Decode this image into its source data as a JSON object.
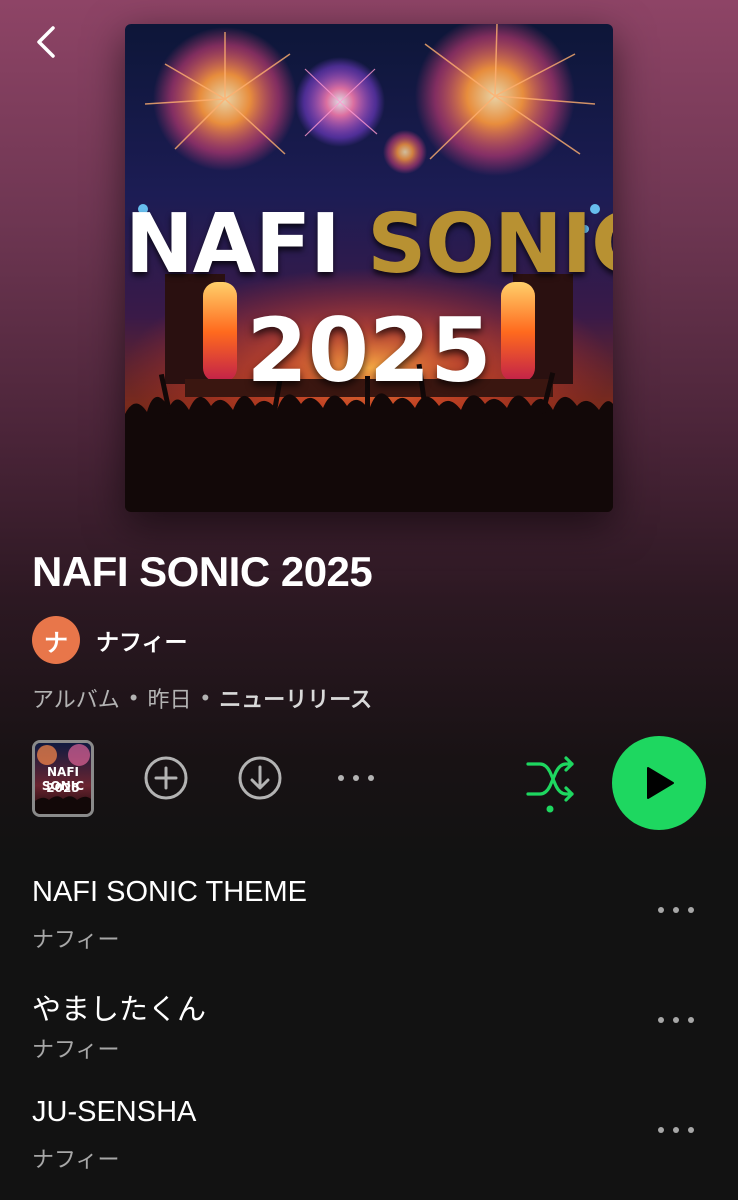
{
  "header": {
    "back_icon": "chevron-left-icon"
  },
  "cover": {
    "line1_word1": "NAFI",
    "line1_word2": "SONIC",
    "line2": "2025",
    "colors": {
      "white": "#ffffff",
      "gold": "#b89132"
    }
  },
  "album": {
    "title": "NAFI SONIC 2025",
    "artist_initial": "ナ",
    "artist_name": "ナフィー",
    "avatar_color": "#e8764a",
    "meta": {
      "type": "アルバム",
      "separator": "•",
      "date": "昨日",
      "badge": "ニューリリース"
    }
  },
  "actions": {
    "mini_cover_line1": "NAFI SONIC",
    "mini_cover_line2": "2025",
    "add_icon": "add-circle-icon",
    "download_icon": "download-circle-icon",
    "more_icon": "more-horizontal-icon",
    "shuffle_icon": "shuffle-icon",
    "play_icon": "play-icon",
    "accent_color": "#1ed760"
  },
  "tracks": [
    {
      "title": "NAFI SONIC THEME",
      "artist": "ナフィー"
    },
    {
      "title": "やましたくん",
      "artist": "ナフィー"
    },
    {
      "title": "JU-SENSHA",
      "artist": "ナフィー"
    }
  ]
}
